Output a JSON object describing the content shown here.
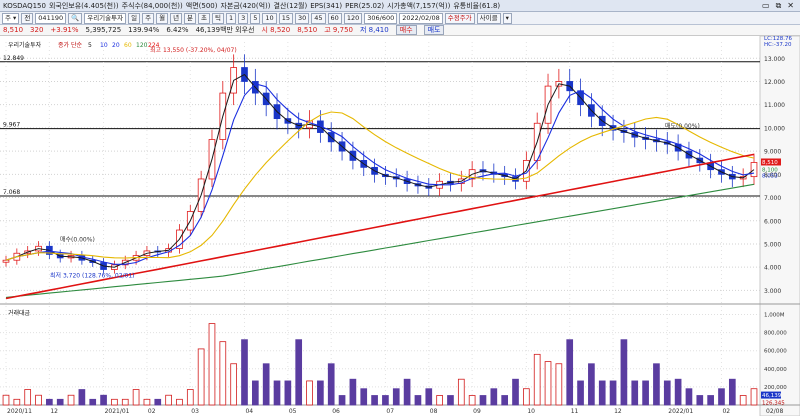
{
  "stock_info_bar": {
    "items": [
      "KOSDAQ150",
      "외국인보유(4.405(천))",
      "주식수(84,000(천))",
      "액면(500)",
      "자본금(420(억))",
      "결산(12월)",
      "EPS(341)",
      "PER(25.02)",
      "시가총액(7,157(억))",
      "유통비율(61.8)"
    ],
    "window_controls": [
      "▭",
      "⧉",
      "✕"
    ]
  },
  "toolbar": {
    "type_select": "주",
    "code_prefix": "전",
    "stock_code": "041190",
    "period_buttons": [
      "일",
      "주",
      "월",
      "년",
      "분",
      "초",
      "틱",
      "1",
      "3",
      "5",
      "10",
      "15",
      "30",
      "45",
      "60",
      "120"
    ],
    "count_display": "306/600",
    "date_value": "2022/02/08",
    "extra_buttons": [
      "수정주가",
      "사이클",
      "▾"
    ]
  },
  "price_bar": {
    "price": "8,510",
    "change": "320",
    "change_pct": "+3.91%",
    "volume": "5,395,725",
    "turnover_pct": "139.94%",
    "value": "6.42%",
    "amount": "46,139백만 외우선",
    "sise": "시 8,520",
    "sise2": "8,510",
    "high": "고 9,750",
    "low": "저 8,410",
    "buy_btn": "매수",
    "sell_btn": "매도"
  },
  "price_chart": {
    "legend_name": "우리기술투자",
    "legend_ma_label": "종가 단순",
    "ma_periods": [
      "5",
      "10",
      "20",
      "60",
      "120",
      "224"
    ],
    "hlines": [
      "12.849",
      "9.967",
      "7.068"
    ],
    "annotation_max": "최고 13,550 (-37.20%, 04/07)",
    "annotation_min": "최저 3,720 (128.76%, 02/01)",
    "annotation_mid": "매도(0.00%)",
    "annotation_left": "매수(0.00%)",
    "y_ticks": [
      "13.000",
      "12.000",
      "11.000",
      "10.000",
      "9.000",
      "8.000",
      "7.000",
      "6.000",
      "5.000",
      "4.000",
      "3.000"
    ],
    "lc_label": "LC:128.76",
    "hc_label": "HC:-37.20",
    "current_label": "8,510",
    "ma_label_a": "8,100",
    "ma_label_b": "8,053"
  },
  "volume_chart": {
    "title": "거래대금",
    "y_ticks": [
      "1,000M",
      "800,000",
      "600,000",
      "400,000",
      "200,000"
    ],
    "current_label": "46,139",
    "current_label_b": "126,345"
  },
  "x_axis": {
    "labels": [
      "2020/11",
      "12",
      "2021/01",
      "02",
      "03",
      "04",
      "05",
      "06",
      "07",
      "08",
      "09",
      "10",
      "11",
      "12",
      "2022/01",
      "02"
    ],
    "corner": "02/08"
  },
  "colors": {
    "bg_header": "#dfe6f2",
    "up": "#e01b1b",
    "down": "#1a36c8",
    "ma5": "#1a1a1a",
    "ma10": "#1b2fe0",
    "ma60": "#e6b800",
    "ma120": "#2e8b3f",
    "ma224": "#e01212"
  }
}
